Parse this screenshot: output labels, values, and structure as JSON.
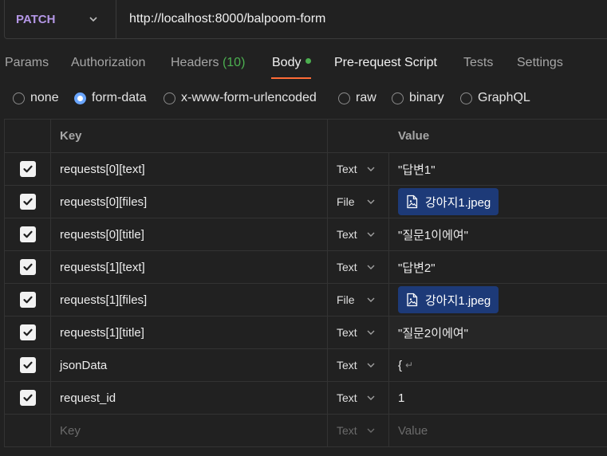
{
  "request": {
    "method": "PATCH",
    "url": "http://localhost:8000/balpoom-form"
  },
  "tabs": [
    {
      "label": "Params"
    },
    {
      "label": "Authorization"
    },
    {
      "label": "Headers",
      "count": "(10)"
    },
    {
      "label": "Body"
    },
    {
      "label": "Pre-request Script"
    },
    {
      "label": "Tests"
    },
    {
      "label": "Settings"
    }
  ],
  "body_types": [
    {
      "label": "none"
    },
    {
      "label": "form-data",
      "selected": true
    },
    {
      "label": "x-www-form-urlencoded"
    },
    {
      "label": "raw"
    },
    {
      "label": "binary"
    },
    {
      "label": "GraphQL"
    }
  ],
  "table": {
    "headers": {
      "key": "Key",
      "value": "Value"
    },
    "rows": [
      {
        "key": "requests[0][text]",
        "type": "Text",
        "value": "\"답변1\""
      },
      {
        "key": "requests[0][files]",
        "type": "File",
        "value": "강아지1.jpeg"
      },
      {
        "key": "requests[0][title]",
        "type": "Text",
        "value": "\"질문1이에여\""
      },
      {
        "key": "requests[1][text]",
        "type": "Text",
        "value": "\"답변2\""
      },
      {
        "key": "requests[1][files]",
        "type": "File",
        "value": "강아지1.jpeg"
      },
      {
        "key": "requests[1][title]",
        "type": "Text",
        "value": "\"질문2이에여\""
      },
      {
        "key": "jsonData",
        "type": "Text",
        "value": "{",
        "newline": "↵"
      },
      {
        "key": "request_id",
        "type": "Text",
        "value": "1"
      }
    ],
    "new_row": {
      "key_placeholder": "Key",
      "type": "Text",
      "value_placeholder": "Value"
    }
  },
  "colors": {
    "background": "#212121",
    "method": "#b497e6",
    "accent_underline": "#ff6c37",
    "status_green": "#4caf50",
    "file_chip": "#1d3a78",
    "radio_selected": "#6aa6ff"
  },
  "icons": {
    "method_dropdown": "chevron-down-icon",
    "checkbox": "checkmark-icon",
    "file": "file-image-icon",
    "type_dropdown": "chevron-down-icon"
  }
}
